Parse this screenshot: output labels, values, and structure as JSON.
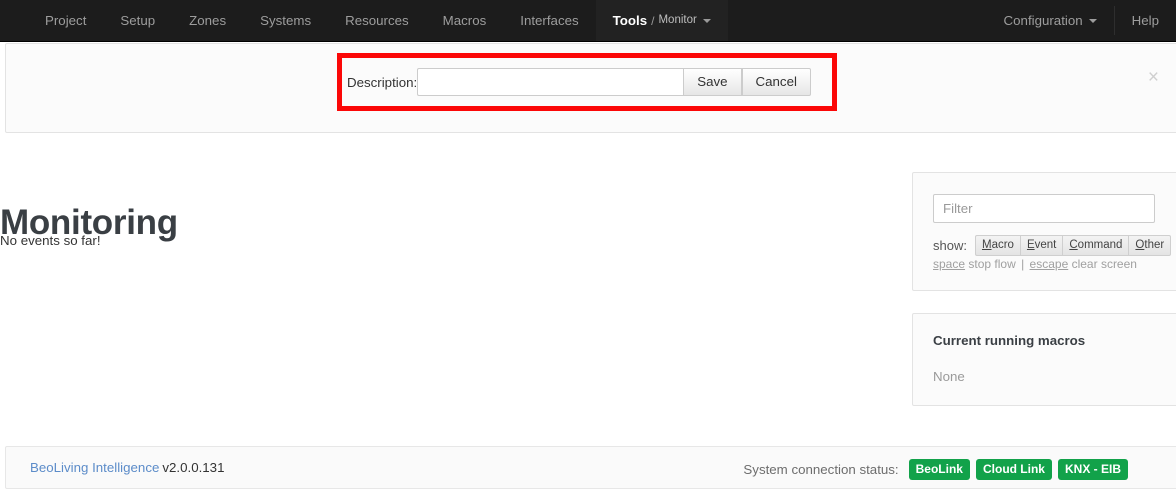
{
  "navbar": {
    "items": [
      {
        "label": "Project"
      },
      {
        "label": "Setup"
      },
      {
        "label": "Zones"
      },
      {
        "label": "Systems"
      },
      {
        "label": "Resources"
      },
      {
        "label": "Macros"
      },
      {
        "label": "Interfaces"
      }
    ],
    "active": {
      "primary": "Tools",
      "separator": "/",
      "secondary": "Monitor"
    },
    "right": [
      {
        "label": "Configuration",
        "caret": true
      },
      {
        "label": "Help",
        "caret": false
      }
    ]
  },
  "description_bar": {
    "label": "Description:",
    "input_value": "",
    "input_placeholder": "",
    "save_label": "Save",
    "cancel_label": "Cancel",
    "close_icon": "×",
    "highlight_color": "#fb0707"
  },
  "main": {
    "title": "Monitoring",
    "empty_message": "No events so far!"
  },
  "filter_panel": {
    "filter_placeholder": "Filter",
    "filter_value": "",
    "show_label": "show:",
    "show_buttons": [
      {
        "accel": "M",
        "rest": "acro"
      },
      {
        "accel": "E",
        "rest": "vent"
      },
      {
        "accel": "C",
        "rest": "ommand"
      },
      {
        "accel": "O",
        "rest": "ther"
      }
    ],
    "hints": {
      "key1": "space",
      "text1": "stop flow",
      "divider": "|",
      "key2": "escape",
      "text2": "clear screen"
    }
  },
  "macros_panel": {
    "title": "Current running macros",
    "value": "None"
  },
  "footer": {
    "product": "BeoLiving Intelligence",
    "version": "v2.0.0.131",
    "status_label": "System connection status:",
    "badges": [
      {
        "label": "BeoLink",
        "color": "#12a24a"
      },
      {
        "label": "Cloud Link",
        "color": "#12a24a"
      },
      {
        "label": "KNX - EIB",
        "color": "#12a24a"
      }
    ]
  }
}
